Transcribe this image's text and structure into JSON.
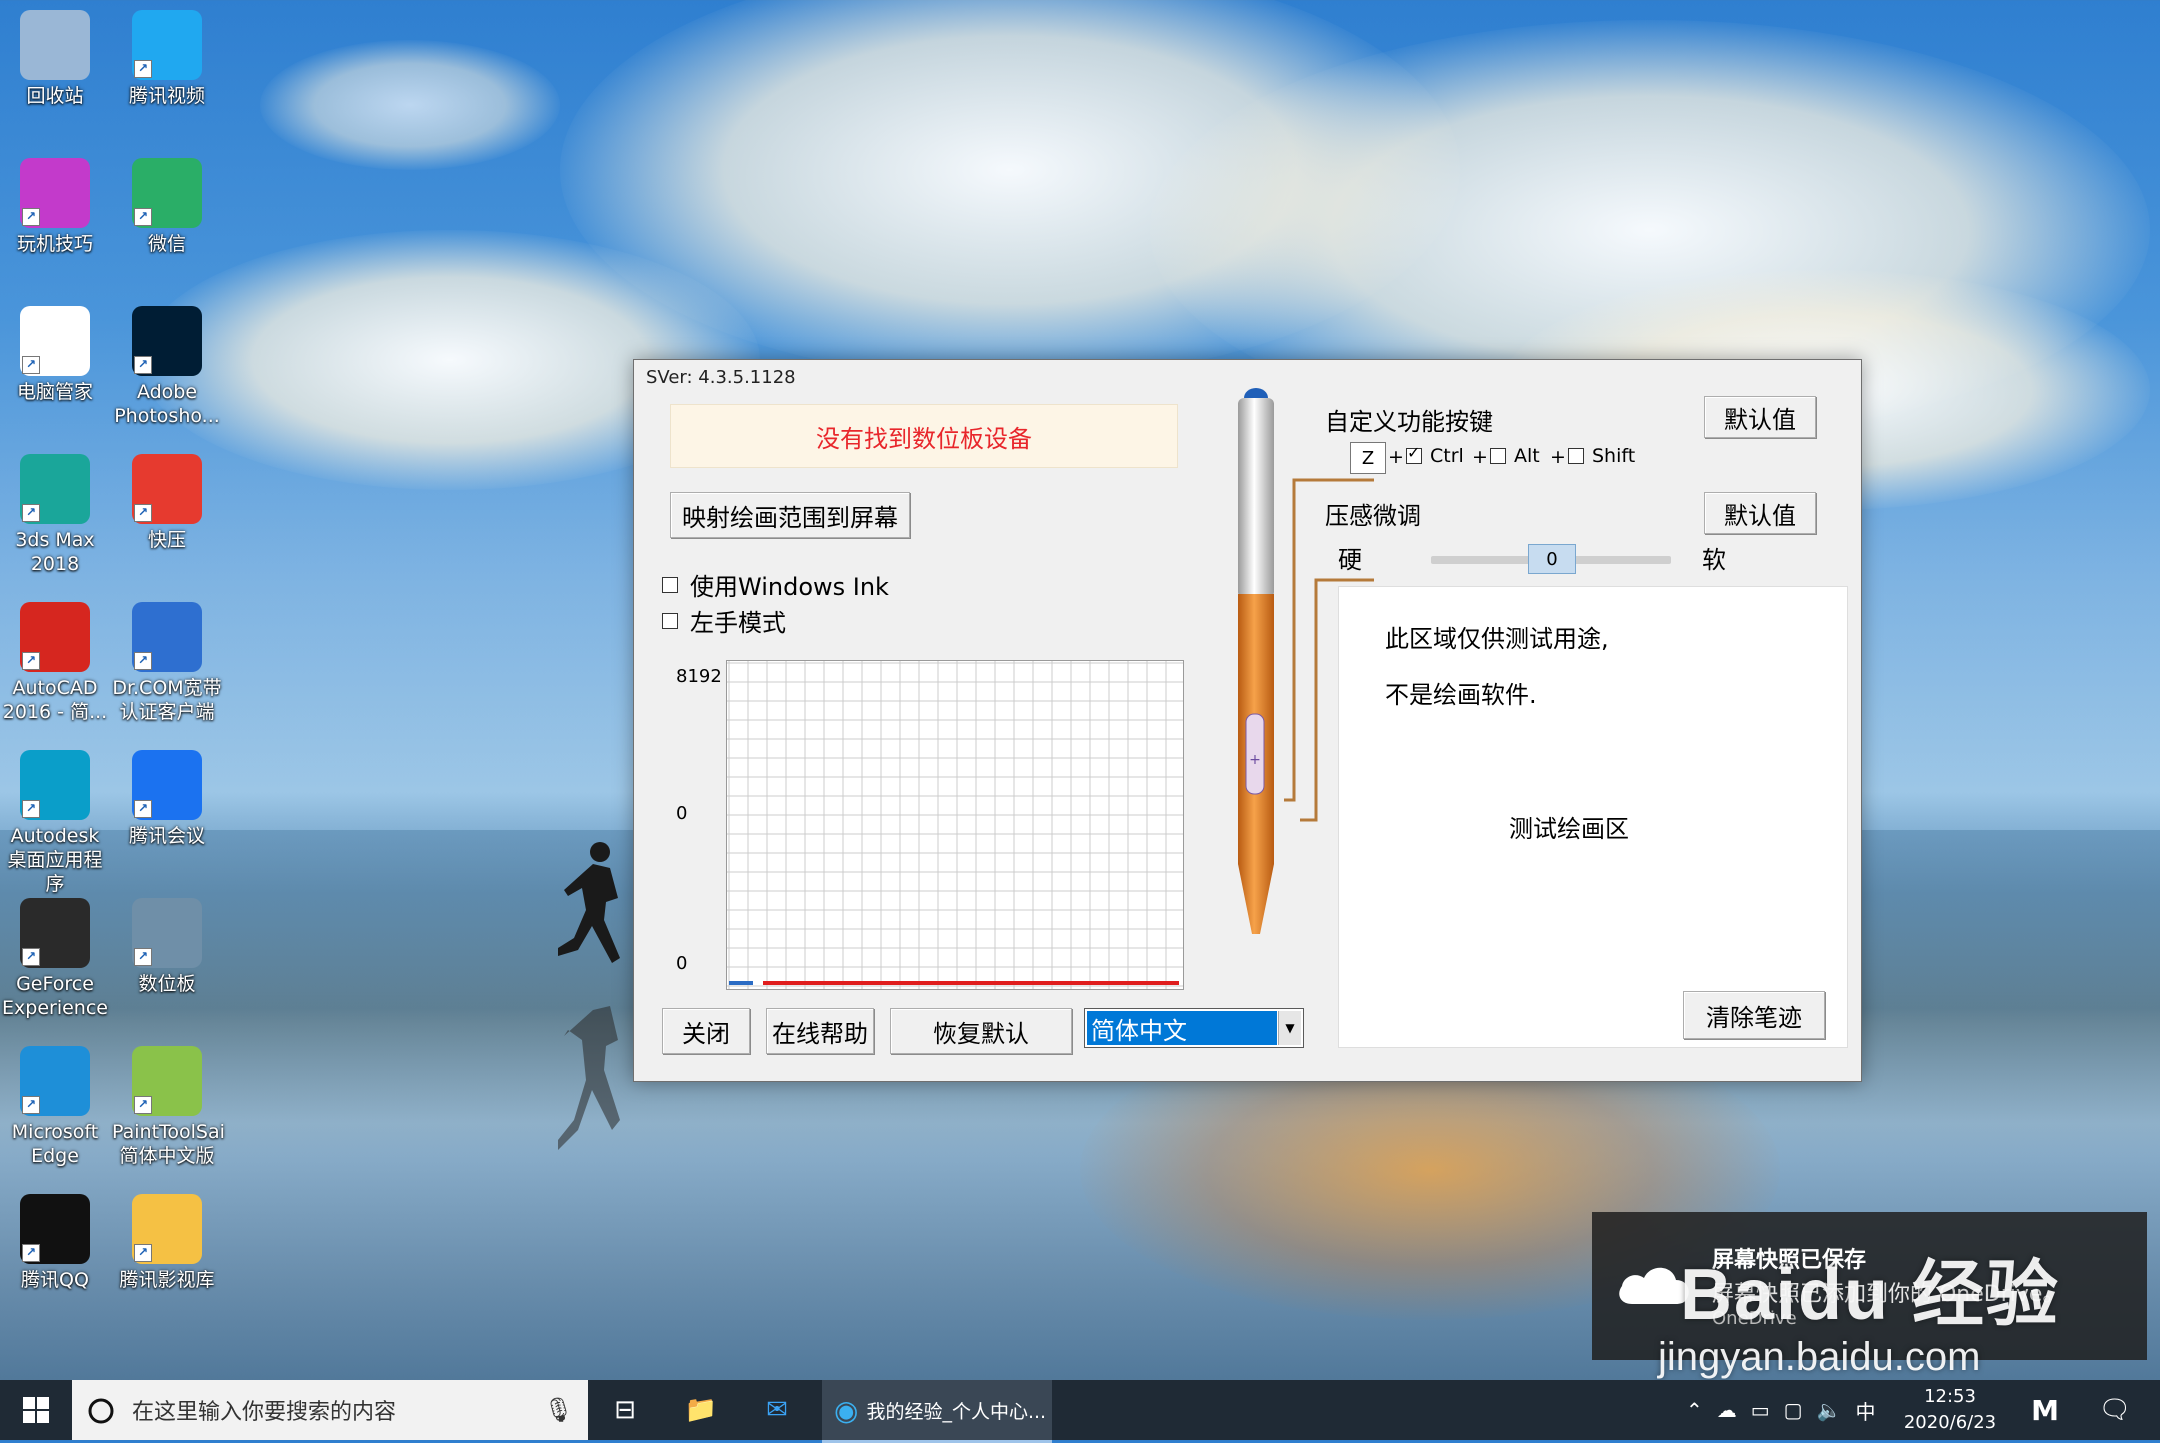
{
  "desktop_icons": [
    {
      "label": "回收站",
      "icon": "recycle-bin-icon",
      "color": "#9ab7d6"
    },
    {
      "label": "腾讯视频",
      "icon": "tencent-video-icon",
      "color": "#20a8f0"
    },
    {
      "label": "玩机技巧",
      "icon": "tips-icon",
      "color": "#c33acb"
    },
    {
      "label": "微信",
      "icon": "wechat-icon",
      "color": "#2aae67"
    },
    {
      "label": "电脑管家",
      "icon": "pc-manager-icon",
      "color": "#ffffff"
    },
    {
      "label": "Adobe Photosho...",
      "icon": "photoshop-icon",
      "color": "#001d34"
    },
    {
      "label": "3ds Max 2018",
      "icon": "3dsmax-icon",
      "color": "#1aa69a"
    },
    {
      "label": "快压",
      "icon": "kuaiya-icon",
      "color": "#e63a2f"
    },
    {
      "label": "AutoCAD 2016 - 简...",
      "icon": "autocad-icon",
      "color": "#d6261f"
    },
    {
      "label": "Dr.COM宽带认证客户端",
      "icon": "drcom-icon",
      "color": "#2e6fd0"
    },
    {
      "label": "Autodesk 桌面应用程序",
      "icon": "autodesk-icon",
      "color": "#0a9ec9"
    },
    {
      "label": "腾讯会议",
      "icon": "tencent-meeting-icon",
      "color": "#1b72f0"
    },
    {
      "label": "GeForce Experience",
      "icon": "geforce-icon",
      "color": "#2a2a2a"
    },
    {
      "label": "数位板",
      "icon": "tablet-icon",
      "color": "#6f8fa8"
    },
    {
      "label": "Microsoft Edge",
      "icon": "edge-icon",
      "color": "#1e8fd8"
    },
    {
      "label": "PaintToolSai 简体中文版",
      "icon": "painttoolsai-icon",
      "color": "#8ac24a"
    },
    {
      "label": "腾讯QQ",
      "icon": "qq-icon",
      "color": "#111111"
    },
    {
      "label": "腾讯影视库",
      "icon": "tencent-film-icon",
      "color": "#f5c144"
    }
  ],
  "dialog": {
    "version": "SVer: 4.3.5.1128",
    "error_text": "没有找到数位板设备",
    "map_button": "映射绘画范围到屏幕",
    "windows_ink_label": "使用Windows Ink",
    "left_hand_label": "左手模式",
    "graph": {
      "y_top": "8192",
      "y_mid": "0",
      "y_bottom": "0"
    },
    "custom_key_label": "自定义功能按键",
    "default_button_1": "默认值",
    "key_value": "Z",
    "plus": "+",
    "ctrl_label": "Ctrl",
    "alt_label": "Alt",
    "shift_label": "Shift",
    "pressure_label": "压感微调",
    "default_button_2": "默认值",
    "hard_label": "硬",
    "soft_label": "软",
    "slider_value": "0",
    "slider_fraction": 0.5,
    "test_line1": "此区域仅供测试用途,",
    "test_line2": "不是绘画软件.",
    "test_area_label": "测试绘画区",
    "clear_button": "清除笔迹",
    "close_button": "关闭",
    "help_button": "在线帮助",
    "restore_button": "恢复默认",
    "language_value": "简体中文"
  },
  "toast": {
    "title": "屏幕快照已保存",
    "body": "屏幕快照已添加到你的 OneDrive。",
    "source": "OneDrive"
  },
  "watermark": {
    "brand": "Baidu 经验",
    "url": "jingyan.baidu.com"
  },
  "taskbar": {
    "search_placeholder": "在这里输入你要搜索的内容",
    "active_app": "我的经验_个人中心...",
    "ime": "中",
    "time": "12:53",
    "date": "2020/6/23"
  }
}
